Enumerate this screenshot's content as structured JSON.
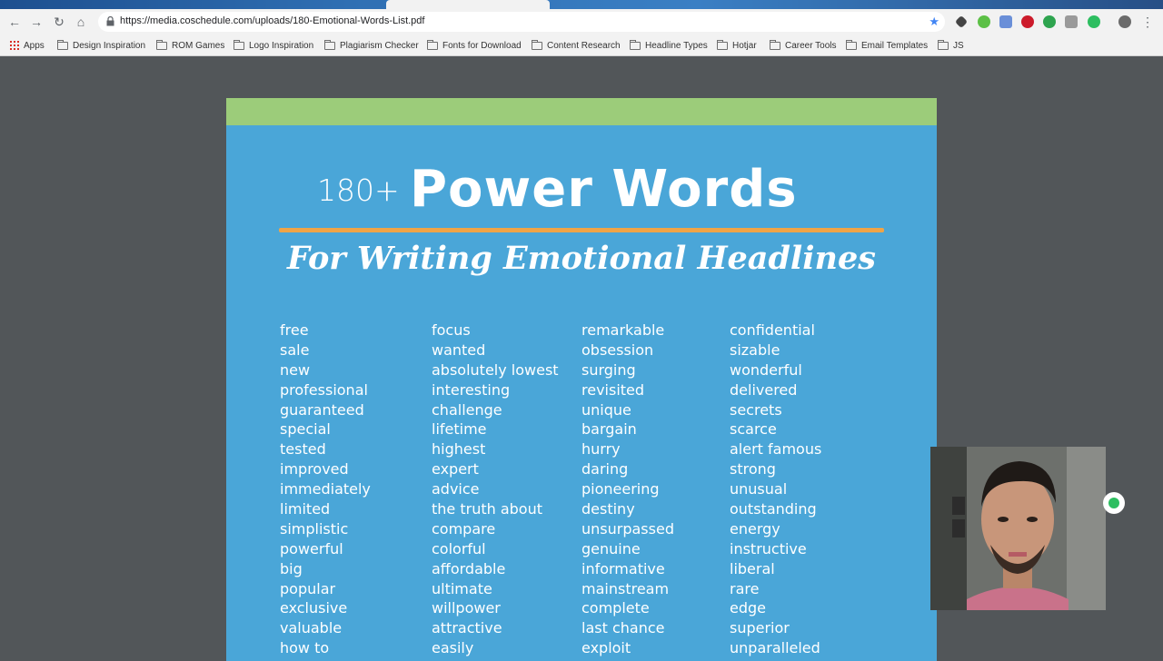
{
  "browser": {
    "url": "https://media.coschedule.com/uploads/180-Emotional-Words-List.pdf",
    "icons": {
      "back": "arrow-left-icon",
      "forward": "arrow-right-icon",
      "reload": "reload-icon",
      "home": "home-icon",
      "lock": "lock-icon",
      "star": "star-icon",
      "menu": "vertical-dots-icon"
    },
    "glyphs": {
      "back": "←",
      "forward": "→",
      "reload": "↻",
      "home": "⌂",
      "star": "★",
      "menu": "⋮"
    },
    "bookmarks": [
      "Apps",
      "Design Inspiration",
      "ROM Games",
      "Logo Inspiration",
      "Plagiarism Checker",
      "Fonts for Download",
      "Content Research",
      "Headline Types",
      "Hotjar",
      "Career Tools",
      "Email Templates",
      "JS"
    ]
  },
  "document": {
    "count_label": "180+",
    "title": "Power Words",
    "subtitle": "For Writing Emotional Headlines",
    "colors": {
      "page": "#4aa6d8",
      "band": "#9ccc7a",
      "rule": "#f0a447"
    },
    "columns": [
      [
        "free",
        "sale",
        "new",
        "professional",
        "guaranteed",
        "special",
        "tested",
        "improved",
        "immediately",
        "limited",
        "simplistic",
        "powerful",
        "big",
        "popular",
        "exclusive",
        "valuable",
        "how to"
      ],
      [
        "focus",
        "wanted",
        "absolutely lowest",
        "interesting",
        "challenge",
        "lifetime",
        "highest",
        "expert",
        "advice",
        "the truth about",
        "compare",
        "colorful",
        "affordable",
        "ultimate",
        "willpower",
        "attractive",
        "easily"
      ],
      [
        "remarkable",
        "obsession",
        "surging",
        "revisited",
        "unique",
        "bargain",
        "hurry",
        "daring",
        "pioneering",
        "destiny",
        "unsurpassed",
        "genuine",
        "informative",
        "mainstream",
        "complete",
        "last chance",
        "exploit"
      ],
      [
        "confidential",
        "sizable",
        "wonderful",
        "delivered",
        "secrets",
        "scarce",
        "alert famous",
        "strong",
        "unusual",
        "outstanding",
        "energy",
        "instructive",
        "liberal",
        "rare",
        "edge",
        "superior",
        "unparalleled"
      ]
    ]
  }
}
